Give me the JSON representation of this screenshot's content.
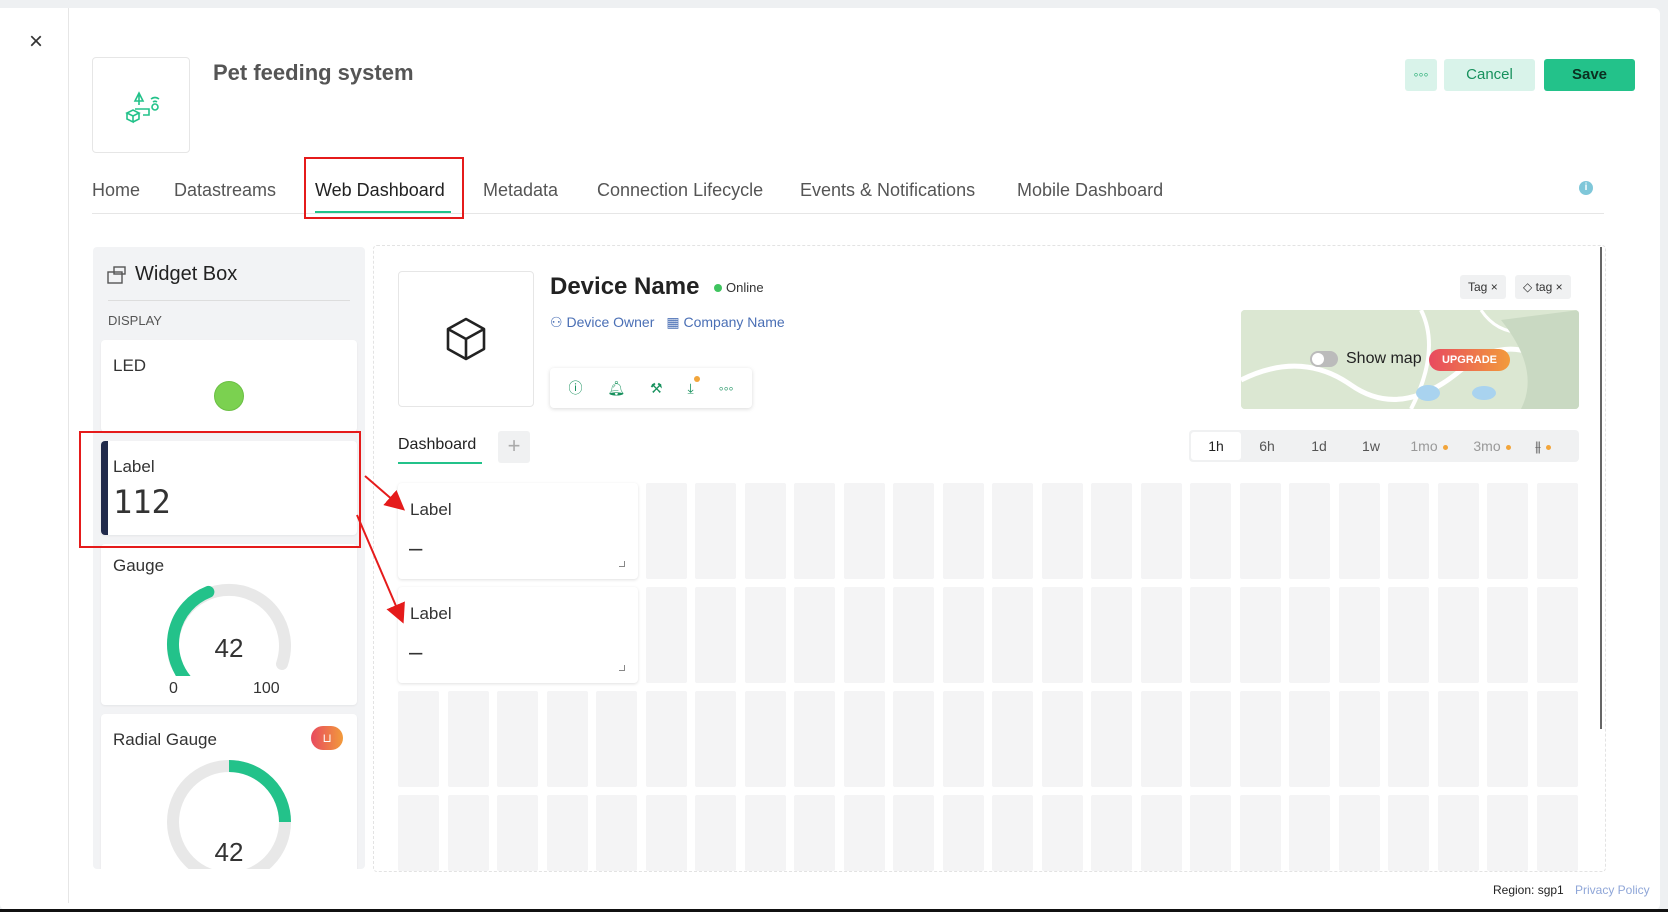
{
  "header": {
    "close_icon": "close-icon",
    "title": "Pet feeding system",
    "more_label": "◦◦◦",
    "cancel_label": "Cancel",
    "save_label": "Save"
  },
  "tabs": [
    {
      "label": "Home"
    },
    {
      "label": "Datastreams"
    },
    {
      "label": "Web Dashboard",
      "active": true
    },
    {
      "label": "Metadata"
    },
    {
      "label": "Connection Lifecycle"
    },
    {
      "label": "Events & Notifications"
    },
    {
      "label": "Mobile Dashboard"
    }
  ],
  "widget_box": {
    "title": "Widget Box",
    "section": "DISPLAY",
    "led": {
      "label": "LED"
    },
    "label_widget": {
      "label": "Label",
      "value": "112"
    },
    "gauge": {
      "label": "Gauge",
      "value": "42",
      "min": "0",
      "max": "100",
      "fraction": 0.42
    },
    "radial_gauge": {
      "label": "Radial Gauge",
      "value": "42"
    }
  },
  "device": {
    "name": "Device Name",
    "status": "Online",
    "owner": "Device Owner",
    "company": "Company Name",
    "tags": [
      "Tag",
      "tag"
    ],
    "show_map_label": "Show map",
    "upgrade_label": "UPGRADE"
  },
  "dashboard": {
    "tab_label": "Dashboard",
    "add_label": "+",
    "time_ranges": [
      {
        "label": "1h",
        "selected": true
      },
      {
        "label": "6h"
      },
      {
        "label": "1d"
      },
      {
        "label": "1w"
      },
      {
        "label": "1mo",
        "premium": true
      },
      {
        "label": "3mo",
        "premium": true
      }
    ],
    "widgets": [
      {
        "label": "Label",
        "value": "–"
      },
      {
        "label": "Label",
        "value": "–"
      }
    ]
  },
  "footer": {
    "region": "Region: sgp1",
    "privacy": "Privacy Policy"
  },
  "colors": {
    "accent": "#23c28a",
    "highlight": "#e51b1b",
    "link": "#4a6fb5"
  }
}
